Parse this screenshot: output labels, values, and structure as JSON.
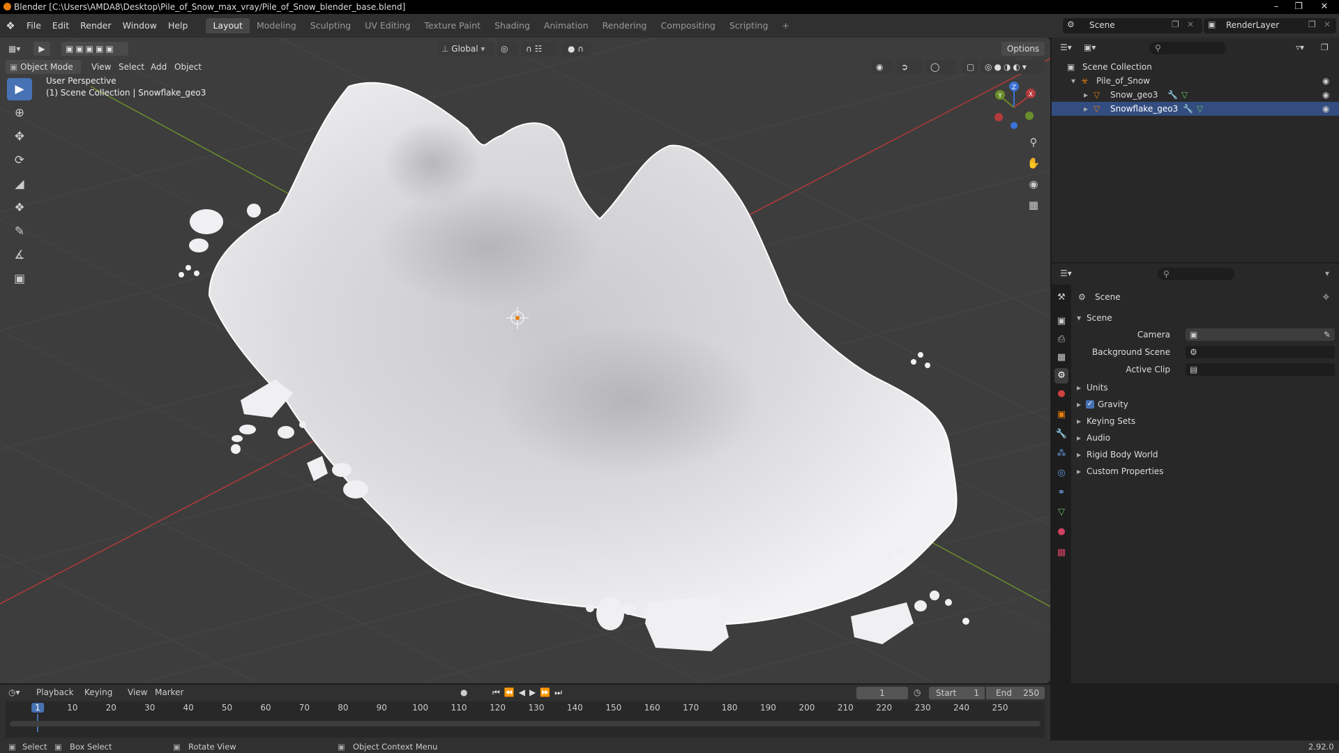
{
  "window": {
    "title": "Blender [C:\\Users\\AMDA8\\Desktop\\Pile_of_Snow_max_vray/Pile_of_Snow_blender_base.blend]"
  },
  "menu": [
    "File",
    "Edit",
    "Render",
    "Window",
    "Help"
  ],
  "workspaces": [
    "Layout",
    "Modeling",
    "Sculpting",
    "UV Editing",
    "Texture Paint",
    "Shading",
    "Animation",
    "Rendering",
    "Compositing",
    "Scripting",
    "+"
  ],
  "scene_field": "Scene",
  "renderlayer_field": "RenderLayer",
  "viewport": {
    "mode": "Object Mode",
    "menus": [
      "View",
      "Select",
      "Add",
      "Object"
    ],
    "transform_orientation": "Global",
    "options_label": "Options",
    "overlay_title": "User Perspective",
    "overlay_subtitle": "(1) Scene Collection | Snowflake_geo3",
    "gizmo": {
      "x": "X",
      "y": "Y",
      "z": "Z"
    }
  },
  "outliner": {
    "root": "Scene Collection",
    "collection": "Pile_of_Snow",
    "objects": [
      "Snow_geo3",
      "Snowflake_geo3"
    ]
  },
  "properties": {
    "context": "Scene",
    "panel": "Scene",
    "fields": [
      {
        "label": "Camera"
      },
      {
        "label": "Background Scene"
      },
      {
        "label": "Active Clip"
      }
    ],
    "sections": [
      "Units",
      "Gravity",
      "Keying Sets",
      "Audio",
      "Rigid Body World",
      "Custom Properties"
    ],
    "gravity_checked": true
  },
  "timeline": {
    "menus": [
      "Playback",
      "Keying",
      "View",
      "Marker"
    ],
    "current_frame": "1",
    "start_label": "Start",
    "start": "1",
    "end_label": "End",
    "end": "250",
    "ticks": [
      "1",
      "10",
      "20",
      "30",
      "40",
      "50",
      "60",
      "70",
      "80",
      "90",
      "100",
      "110",
      "120",
      "130",
      "140",
      "150",
      "160",
      "170",
      "180",
      "190",
      "200",
      "210",
      "220",
      "230",
      "240",
      "250"
    ]
  },
  "statusbar": {
    "select": "Select",
    "box_select": "Box Select",
    "rotate": "Rotate View",
    "context_menu": "Object Context Menu",
    "version": "2.92.0"
  },
  "colors": {
    "accent": "#4772b3",
    "axis_x": "#b33a3a",
    "axis_y": "#6a8e2a",
    "axis_z": "#3a72d6"
  }
}
